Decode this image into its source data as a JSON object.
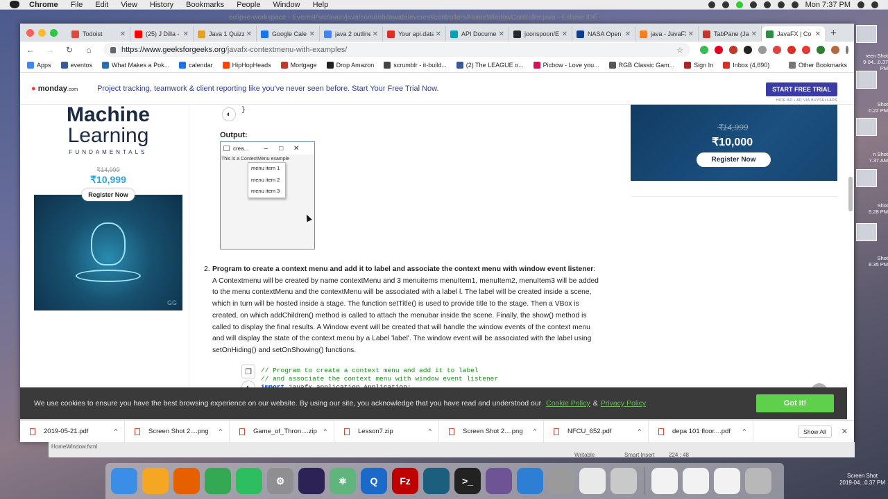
{
  "menubar": {
    "app": "Chrome",
    "items": [
      "File",
      "Edit",
      "View",
      "History",
      "Bookmarks",
      "People",
      "Window",
      "Help"
    ],
    "clock": "Mon 7:37 PM"
  },
  "eclipse": {
    "title": "eclipse-workspace - Everest/src/main/java/com/rohitawate/everest/controllers/HomeWindowController.java - Eclipse IDE",
    "file": "HomeWindow.fxml",
    "writable": "Writable",
    "insert": "Smart Insert",
    "position": "224 : 48"
  },
  "tabs": [
    {
      "label": "Todoist",
      "color": "#db4c3f"
    },
    {
      "label": "(25) J Dilla -",
      "color": "#ff0000"
    },
    {
      "label": "Java 1 Quizz",
      "color": "#e8a020"
    },
    {
      "label": "Google Cale",
      "color": "#1a73e8"
    },
    {
      "label": "java 2 outline",
      "color": "#4285f4"
    },
    {
      "label": "Your api.data",
      "color": "#d93025"
    },
    {
      "label": "API Docume",
      "color": "#00a3b4"
    },
    {
      "label": "joonspoon/E",
      "color": "#24292e"
    },
    {
      "label": "NASA Open",
      "color": "#0b3d91"
    },
    {
      "label": "java - JavaFX",
      "color": "#f48024"
    },
    {
      "label": "TabPane (Ja",
      "color": "#c0392b"
    },
    {
      "label": "JavaFX | Co",
      "color": "#2f8d46"
    }
  ],
  "omnibox": {
    "host": "https://www.geeksforgeeks.org",
    "path": "/javafx-contextmenu-with-examples/"
  },
  "bookmarks": [
    {
      "label": "Apps",
      "color": "#4285f4"
    },
    {
      "label": "eventos",
      "color": "#3b5998"
    },
    {
      "label": "What Makes a Pok...",
      "color": "#2a6fb3"
    },
    {
      "label": "calendar",
      "color": "#1a73e8"
    },
    {
      "label": "HipHopHeads",
      "color": "#ff4500"
    },
    {
      "label": "Mortgage",
      "color": "#c0392b"
    },
    {
      "label": "Drop Amazon",
      "color": "#222222"
    },
    {
      "label": "scrumblr - it-build...",
      "color": "#444444"
    },
    {
      "label": "(2) The LEAGUE o...",
      "color": "#3b5998"
    },
    {
      "label": "Picbow - Love you...",
      "color": "#d4145a"
    },
    {
      "label": "RGB Classic Gam...",
      "color": "#555555"
    },
    {
      "label": "Sign In",
      "color": "#b22222"
    },
    {
      "label": "Inbox (4,690)",
      "color": "#d93025"
    }
  ],
  "other_bookmarks": "Other Bookmarks",
  "adbar": {
    "logo": "monday",
    "logo_suffix": ".com",
    "text": "Project tracking, teamwork & client reporting like you've never seen before. Start Your Free Trial Now.",
    "cta": "START FREE TRIAL",
    "hide": "HIDE AD • AD VIA BUYSELLADS"
  },
  "left_ad": {
    "line1": "Machine",
    "line2": "Learning",
    "line3": "FUNDAMENTALS",
    "old_price": "₹14,999",
    "price": "₹10,999",
    "button": "Register Now",
    "mark": "GG"
  },
  "right_ad": {
    "old_price": "₹14,999",
    "price": "₹10,000",
    "button": "Register Now"
  },
  "content": {
    "brace": "}",
    "output_label": "Output:",
    "fx_window": {
      "title": "crea...",
      "label": "This is a ContextMenu example",
      "menu_items": [
        "menu item 1",
        "menu item 2",
        "menu item 3"
      ]
    },
    "item_number": "2.",
    "heading": "Program to create a context menu and add it to label and associate the context menu with window event listener",
    "body": ": A Contextmenu will be created by name contextMenu and 3 menuitems menuItem1, menuItem2, menuItem3 will be added to the menu contextMenu and the contextMenu will be associated with a label l. The label will be created inside a scene, which in turn will be hosted inside a stage. The function setTitle() is used to provide title to the stage. Then a VBox is created, on which addChildren() method is called to attach the menubar inside the scene. Finally, the show() method is called to display the final results. A Window event will be created that will handle the window events of the context menu and will display the state of the context menu by a Label 'label'. The window event will be associated with the label using setOnHiding() and setOnShowing() functions.",
    "code": {
      "comment1": "// Program to create a context menu and add it to label",
      "comment2": "// and associate the context menu with window event listener",
      "keyword": "import",
      "rest": " javafx.application.Application;"
    }
  },
  "cookie": {
    "text": "We use cookies to ensure you have the best browsing experience on our website. By using our site, you acknowledge that you have read and understood our",
    "link1": "Cookie Policy",
    "amp": "&",
    "link2": "Privacy Policy",
    "button": "Got it!"
  },
  "downloads": [
    {
      "name": "2019-05-21.pdf"
    },
    {
      "name": "Screen Shot 2....png"
    },
    {
      "name": "Game_of_Thron....zip"
    },
    {
      "name": "Lesson7.zip"
    },
    {
      "name": "Screen Shot 2....png"
    },
    {
      "name": "NFCU_652.pdf"
    },
    {
      "name": "depa 101 floor....pdf"
    }
  ],
  "show_all": "Show All",
  "desktop": {
    "shots": [
      {
        "l1": "reen Shot",
        "l2": "9-04...0.37 PM"
      },
      {
        "l1": "Shot",
        "l2": "0.22 PM"
      },
      {
        "l1": "n Shot",
        "l2": "7.37 AM"
      },
      {
        "l1": "Shot",
        "l2": "5.28 PM"
      },
      {
        "l1": "Shot",
        "l2": "8.35 PM"
      }
    ],
    "last_l1": "Screen Shot",
    "last_l2": "2019-04...0.37 PM"
  },
  "dock": [
    {
      "name": "finder",
      "color": "#3a8ee6",
      "glyph": ""
    },
    {
      "name": "messages",
      "color": "#f5a623",
      "glyph": ""
    },
    {
      "name": "firefox",
      "color": "#e66000",
      "glyph": ""
    },
    {
      "name": "chrome",
      "color": "#34a853",
      "glyph": ""
    },
    {
      "name": "evernote",
      "color": "#2dbe60",
      "glyph": ""
    },
    {
      "name": "system-preferences",
      "color": "#8e8e93",
      "glyph": "⚙"
    },
    {
      "name": "eclipse",
      "color": "#2c2255",
      "glyph": ""
    },
    {
      "name": "atom",
      "color": "#5fb57d",
      "glyph": "⚛"
    },
    {
      "name": "quicktime",
      "color": "#1b6ac9",
      "glyph": "Q"
    },
    {
      "name": "filezilla",
      "color": "#bf0000",
      "glyph": "Fz"
    },
    {
      "name": "mysql-workbench",
      "color": "#1c5e7e",
      "glyph": ""
    },
    {
      "name": "terminal",
      "color": "#222222",
      "glyph": ">_"
    },
    {
      "name": "github-desktop",
      "color": "#6e5494",
      "glyph": ""
    },
    {
      "name": "transmit",
      "color": "#2d7fd6",
      "glyph": ""
    },
    {
      "name": "archive-utility",
      "color": "#9a9a9a",
      "glyph": ""
    },
    {
      "name": "textedit",
      "color": "#e9e9e9",
      "glyph": ""
    },
    {
      "name": "preview",
      "color": "#c9c9c9",
      "glyph": ""
    },
    {
      "name": "doc-thumb-1",
      "color": "#f2f2f2",
      "glyph": ""
    },
    {
      "name": "doc-thumb-2",
      "color": "#f2f2f2",
      "glyph": ""
    },
    {
      "name": "doc-thumb-3",
      "color": "#f2f2f2",
      "glyph": ""
    },
    {
      "name": "trash",
      "color": "#b8b8b8",
      "glyph": ""
    }
  ]
}
